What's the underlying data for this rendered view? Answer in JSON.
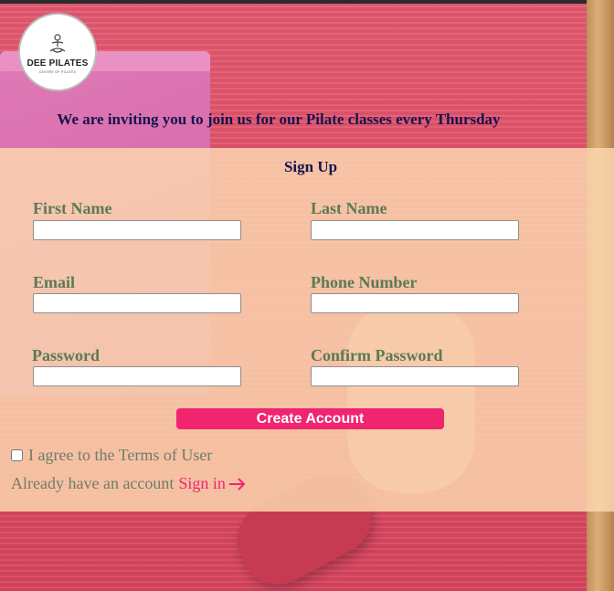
{
  "logo": {
    "title": "DEE PILATES",
    "subtitle": "CENTRE OF PILATES"
  },
  "invite_text": "We are inviting you to join us for our Pilate classes every Thursday",
  "form": {
    "title": "Sign Up",
    "first_name": {
      "label": "First Name",
      "value": ""
    },
    "last_name": {
      "label": "Last Name",
      "value": ""
    },
    "email": {
      "label": "Email",
      "value": ""
    },
    "phone": {
      "label": "Phone Number",
      "value": ""
    },
    "password": {
      "label": "Password",
      "value": ""
    },
    "confirm_password": {
      "label": "Confirm Password",
      "value": ""
    },
    "submit_label": "Create Account",
    "terms_label": "I agree to the Terms of User",
    "terms_checked": false,
    "already_text": "Already have an account",
    "signin_label": "Sign in"
  },
  "colors": {
    "accent": "#f0246f",
    "label": "#5a7a56",
    "heading": "#141450",
    "panel": "#fcd6af"
  },
  "icons": [
    "pilates-figure-icon",
    "arrow-right-icon"
  ]
}
